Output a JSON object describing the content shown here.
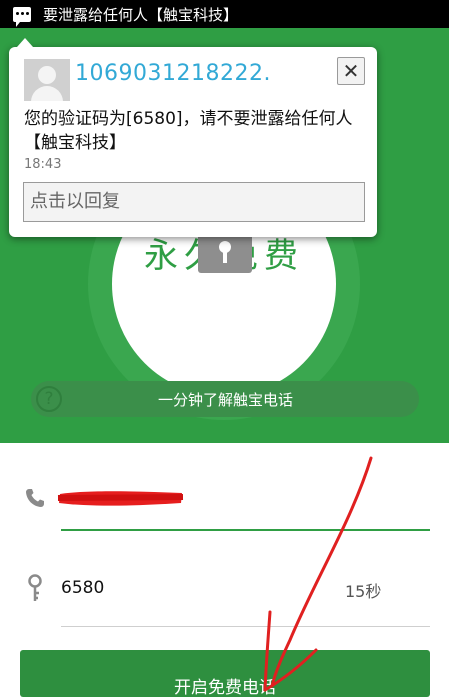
{
  "statusbar": {
    "text": "要泄露给任何人【触宝科技】"
  },
  "notification": {
    "sender": "1069031218222.",
    "close_label": "✕",
    "message": "您的验证码为[6580]，请不要泄露给任何人【触宝科技】",
    "time": "18:43",
    "reply_placeholder": "点击以回复"
  },
  "hero": {
    "background_text": "永久免费",
    "learn_label": "一分钟了解触宝电话",
    "help_glyph": "?"
  },
  "form": {
    "code_value": "6580",
    "countdown": "15秒"
  },
  "start_button": {
    "label": "开启免费电话"
  },
  "colors": {
    "brand_green": "#2f9e44",
    "link_blue": "#32a9d6",
    "annotation_red": "#e02020"
  }
}
